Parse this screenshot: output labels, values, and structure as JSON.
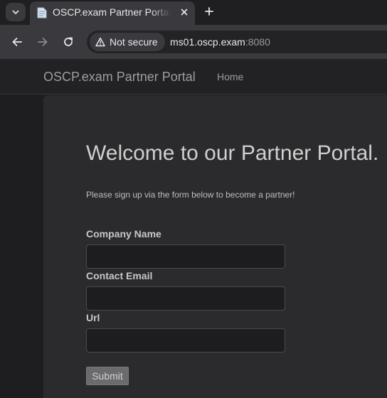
{
  "browser": {
    "tab": {
      "title": "OSCP.exam Partner Portal"
    },
    "security": {
      "text": "Not secure"
    },
    "url": {
      "host": "ms01.oscp.exam",
      "port": ":8080"
    }
  },
  "navbar": {
    "brand": "OSCP.exam Partner Portal",
    "home": "Home"
  },
  "main": {
    "heading": "Welcome to our Partner Portal.",
    "lead": "Please sign up via the form below to become a partner!",
    "form": {
      "company_label": "Company Name",
      "company_value": "",
      "email_label": "Contact Email",
      "email_value": "",
      "url_label": "Url",
      "url_value": "",
      "submit_label": "Submit"
    }
  }
}
